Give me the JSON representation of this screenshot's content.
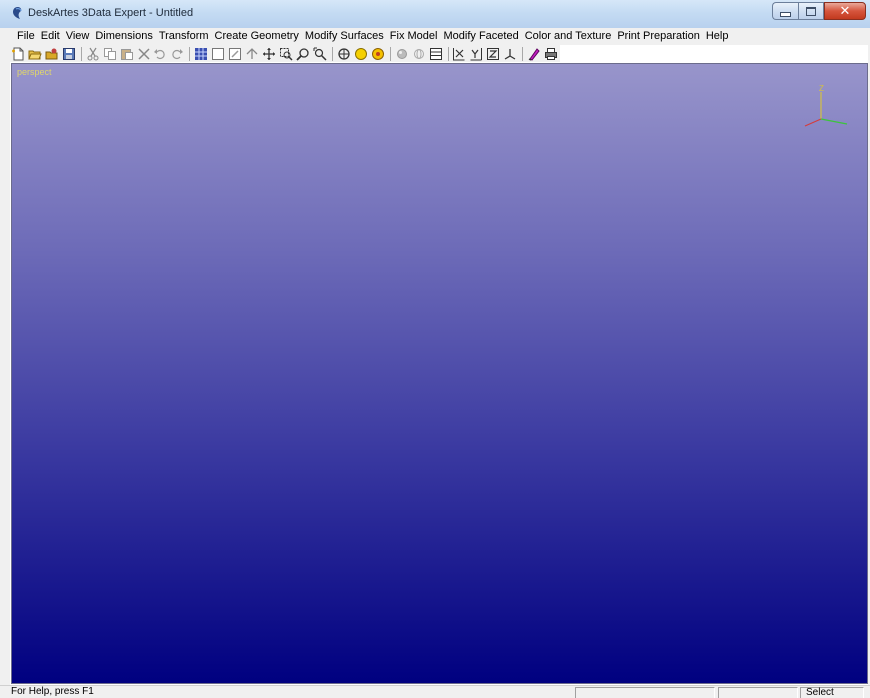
{
  "window": {
    "title": "DeskArtes 3Data Expert - Untitled",
    "close_symbol": "✕",
    "close_color": "#c23a1f"
  },
  "menu": {
    "items": [
      {
        "label": "File"
      },
      {
        "label": "Edit"
      },
      {
        "label": "View"
      },
      {
        "label": "Dimensions"
      },
      {
        "label": "Transform"
      },
      {
        "label": "Create Geometry"
      },
      {
        "label": "Modify Surfaces"
      },
      {
        "label": "Fix Model"
      },
      {
        "label": "Modify Faceted"
      },
      {
        "label": "Color and Texture"
      },
      {
        "label": "Print Preparation"
      },
      {
        "label": "Help"
      }
    ]
  },
  "toolbar": {
    "icons": [
      "new-file-icon",
      "open-folder-icon",
      "open-model-icon",
      "save-icon",
      "cut-icon",
      "copy-icon",
      "paste-icon",
      "delete-icon",
      "undo-icon",
      "redo-icon",
      "grid-icon",
      "frame-icon",
      "edit-frame-icon",
      "select-arrow-icon",
      "pan-icon",
      "zoom-window-icon",
      "zoom-icon",
      "zoom-fit-icon",
      "rotate-icon",
      "shade-icon",
      "lighting-icon",
      "render-icon",
      "wireframe-icon",
      "table-icon",
      "x-view-icon",
      "y-view-icon",
      "z-view-icon",
      "axes-icon",
      "color-icon",
      "print-icon"
    ]
  },
  "viewport": {
    "label": "perspect",
    "gradient_top": "#9895cb",
    "gradient_bottom": "#000080",
    "axis": {
      "z_label": "Z",
      "x_color": "#d43c3c",
      "y_color": "#3cc43c",
      "z_color": "#d4c040"
    }
  },
  "statusbar": {
    "help_text": "For Help, press F1",
    "mode": "Select"
  }
}
